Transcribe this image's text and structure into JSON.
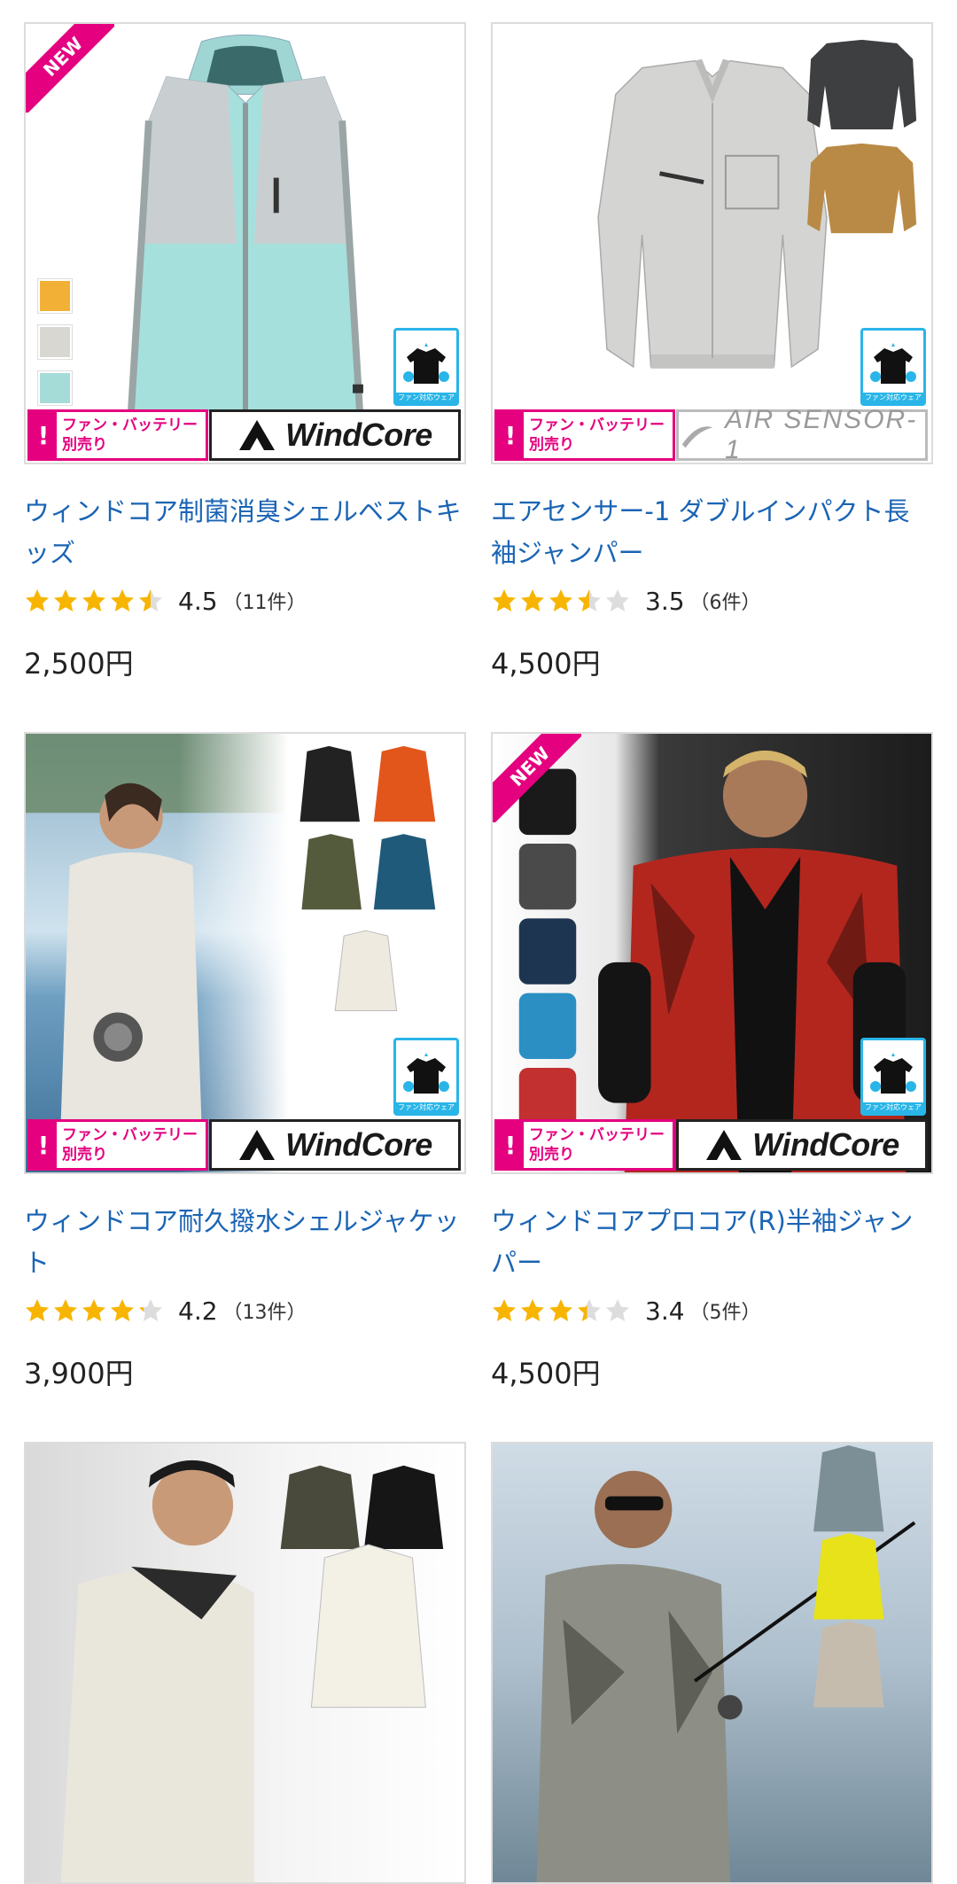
{
  "colors": {
    "link": "#1a64b4",
    "star": "#f7b500",
    "star_empty": "#dddddd",
    "new": "#e4007f",
    "fan_badge": "#29b5e8"
  },
  "badges": {
    "new_label": "NEW",
    "fan_warning": "ファン・バッテリー別売り",
    "fan_warning_line1": "ファン・バッテリー",
    "fan_warning_line2": "別売り",
    "fan_badge_label": "ファン対応ウェア"
  },
  "products": [
    {
      "title": "ウィンドコア制菌消臭シェルベストキッズ",
      "rating": 4.5,
      "rating_text": "4.5",
      "count_text": "（11件）",
      "price": "2,500円",
      "brand": "WindCore",
      "is_new": true,
      "image": "vest-mint-gray"
    },
    {
      "title": "エアセンサー-1 ダブルインパクト長袖ジャンパー",
      "rating": 3.5,
      "rating_text": "3.5",
      "count_text": "（6件）",
      "price": "4,500円",
      "brand": "AIR SENSOR-1",
      "is_new": false,
      "image": "long-sleeve-jacket-gray"
    },
    {
      "title": "ウィンドコア耐久撥水シェルジャケット",
      "rating": 4.2,
      "rating_text": "4.2",
      "count_text": "（13件）",
      "price": "3,900円",
      "brand": "WindCore",
      "is_new": false,
      "image": "woman-shell-jacket"
    },
    {
      "title": "ウィンドコアプロコア(R)半袖ジャンパー",
      "rating": 3.4,
      "rating_text": "3.4",
      "count_text": "（5件）",
      "price": "4,500円",
      "brand": "WindCore",
      "is_new": true,
      "image": "man-red-camo-jacket"
    },
    {
      "title": "",
      "image": "man-short-sleeve-hoodie"
    },
    {
      "title": "",
      "image": "man-fishing-camo"
    }
  ]
}
